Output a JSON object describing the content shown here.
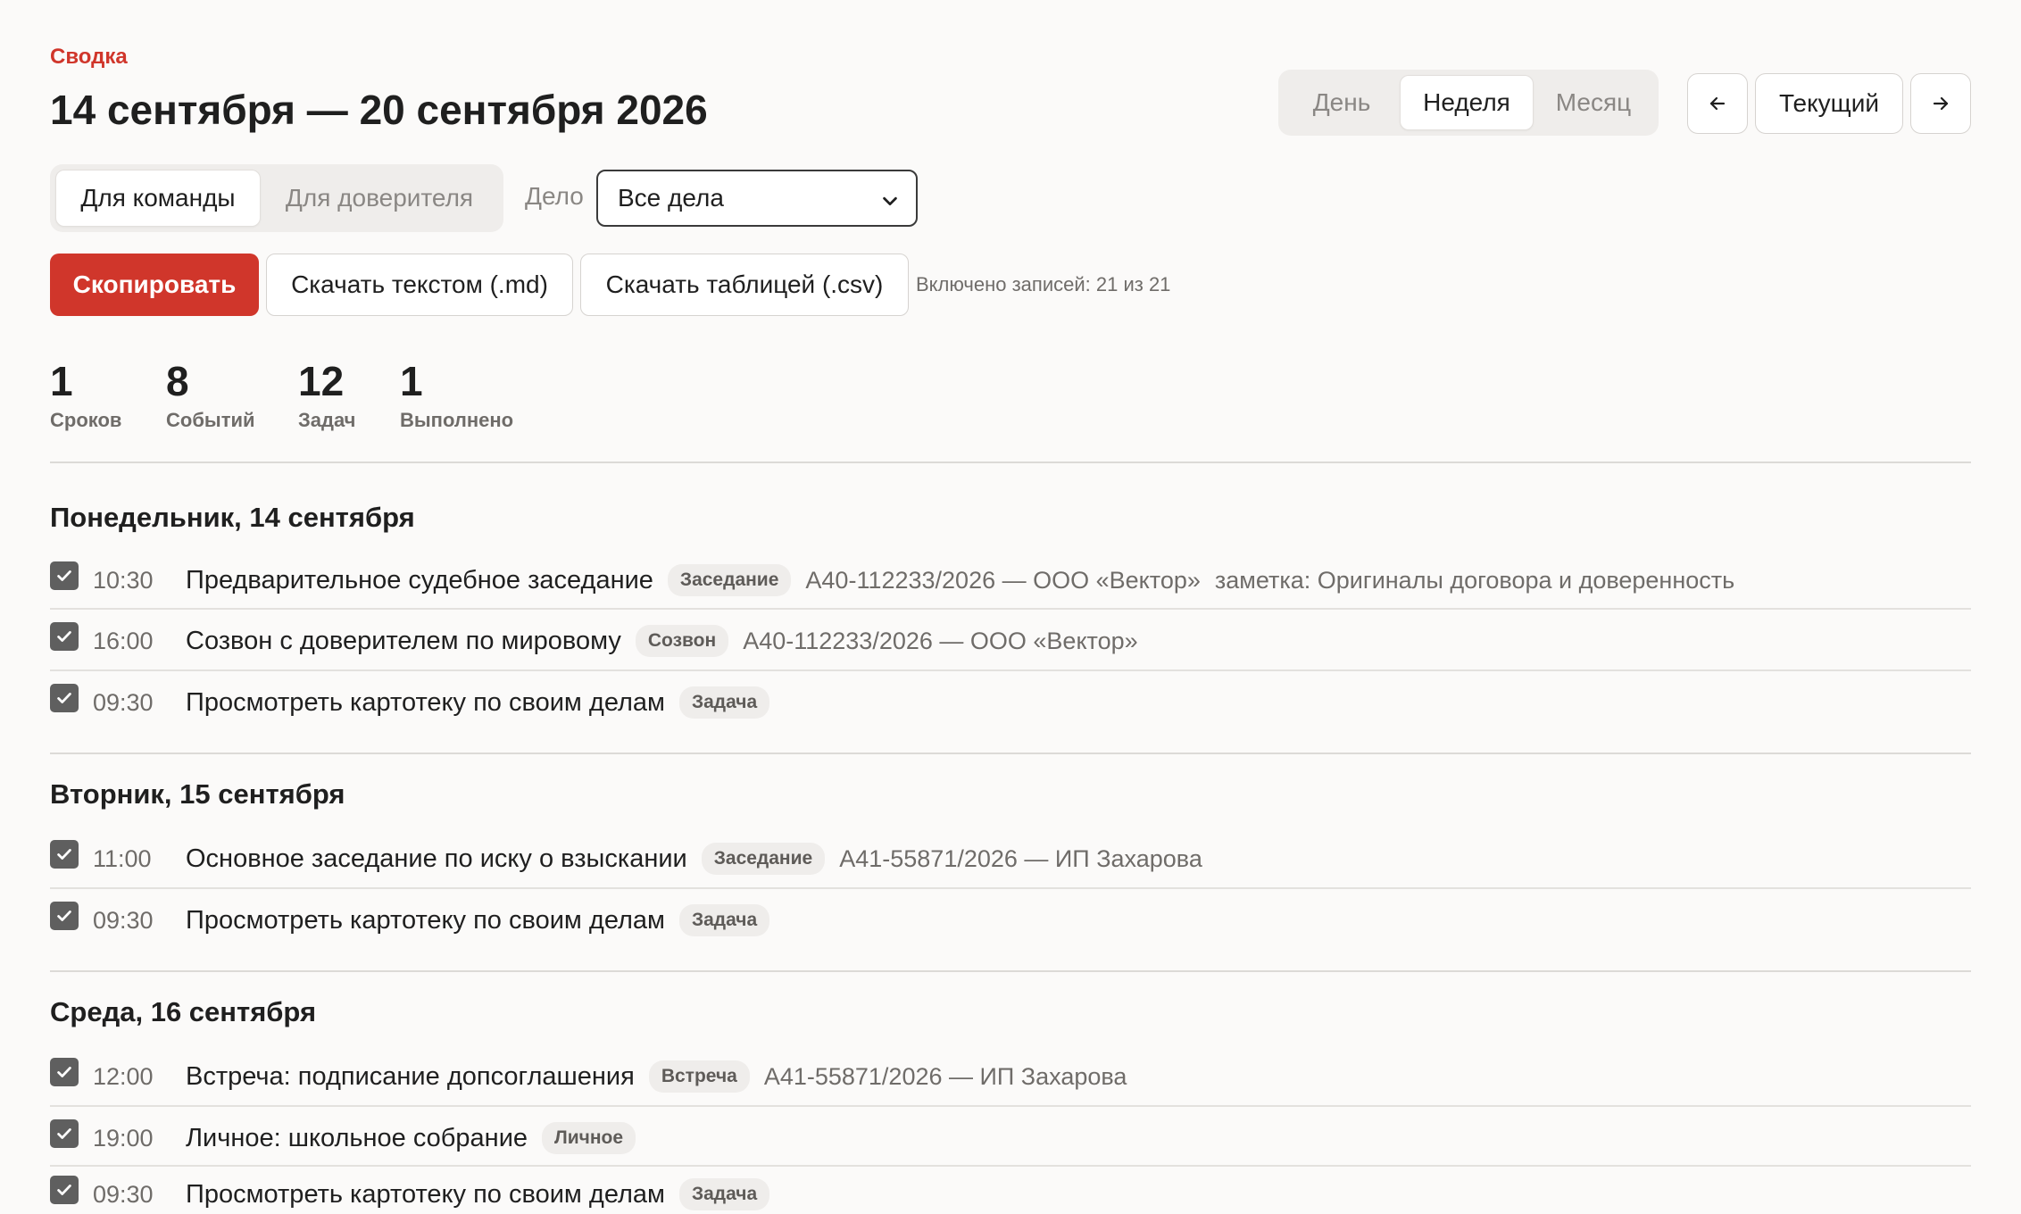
{
  "header": {
    "eyebrow": "Сводка",
    "title": "14 сентября — 20 сентября 2026"
  },
  "period_tabs": [
    {
      "label": "День",
      "active": false
    },
    {
      "label": "Неделя",
      "active": true
    },
    {
      "label": "Месяц",
      "active": false
    }
  ],
  "nav": {
    "prev_icon": "arrow-left-icon",
    "current_label": "Текущий",
    "next_icon": "arrow-right-icon"
  },
  "audience_tabs": [
    {
      "label": "Для команды",
      "active": true
    },
    {
      "label": "Для доверителя",
      "active": false
    }
  ],
  "case_filter": {
    "label": "Дело",
    "selected": "Все дела"
  },
  "actions": {
    "copy": "Скопировать",
    "download_md": "Скачать текстом (.md)",
    "download_csv": "Скачать таблицей (.csv)",
    "included": "Включено записей: 21 из 21"
  },
  "colors": {
    "accent": "#d0362b",
    "check": "#5f5f5f"
  },
  "stats": [
    {
      "value": "1",
      "label": "Сроков"
    },
    {
      "value": "8",
      "label": "Событий"
    },
    {
      "value": "12",
      "label": "Задач"
    },
    {
      "value": "1",
      "label": "Выполнено"
    }
  ],
  "days": [
    {
      "heading": "Понедельник, 14 сентября",
      "items": [
        {
          "checked": true,
          "time": "10:30",
          "title": "Предварительное судебное заседание",
          "badge": "Заседание",
          "case": "А40-112233/2026 — ООО «Вектор»",
          "note": "заметка: Оригиналы договора и доверенность"
        },
        {
          "checked": true,
          "time": "16:00",
          "title": "Созвон с доверителем по мировому",
          "badge": "Созвон",
          "case": "А40-112233/2026 — ООО «Вектор»"
        },
        {
          "checked": true,
          "time": "09:30",
          "title": "Просмотреть картотеку по своим делам",
          "badge": "Задача"
        }
      ]
    },
    {
      "heading": "Вторник, 15 сентября",
      "items": [
        {
          "checked": true,
          "time": "11:00",
          "title": "Основное заседание по иску о взыскании",
          "badge": "Заседание",
          "case": "А41-55871/2026 — ИП Захарова"
        },
        {
          "checked": true,
          "time": "09:30",
          "title": "Просмотреть картотеку по своим делам",
          "badge": "Задача"
        }
      ]
    },
    {
      "heading": "Среда, 16 сентября",
      "items": [
        {
          "checked": true,
          "time": "12:00",
          "title": "Встреча: подписание допсоглашения",
          "badge": "Встреча",
          "case": "А41-55871/2026 — ИП Захарова"
        },
        {
          "checked": true,
          "time": "19:00",
          "title": "Личное: школьное собрание",
          "badge": "Личное"
        },
        {
          "checked": true,
          "time": "09:30",
          "title": "Просмотреть картотеку по своим делам",
          "badge": "Задача"
        }
      ]
    }
  ]
}
